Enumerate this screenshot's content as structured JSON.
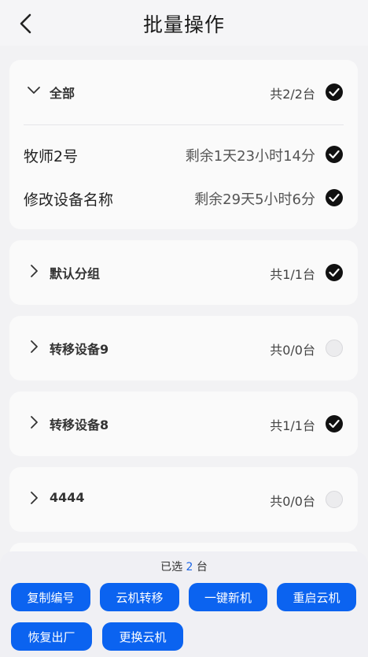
{
  "header": {
    "title": "批量操作",
    "back_icon": "chevron-left-icon"
  },
  "groups": [
    {
      "name": "全部",
      "count": "共2/2台",
      "expanded": true,
      "checked": true,
      "devices": [
        {
          "name": "牧师2号",
          "remaining": "剩余1天23小时14分",
          "checked": true
        },
        {
          "name": "修改设备名称",
          "remaining": "剩余29天5小时6分",
          "checked": true
        }
      ]
    },
    {
      "name": "默认分组",
      "count": "共1/1台",
      "expanded": false,
      "checked": true
    },
    {
      "name": "转移设备9",
      "count": "共0/0台",
      "expanded": false,
      "checked": false
    },
    {
      "name": "转移设备8",
      "count": "共1/1台",
      "expanded": false,
      "checked": true
    },
    {
      "name": "4444",
      "count": "共0/0台",
      "expanded": false,
      "checked": false
    }
  ],
  "footer": {
    "selected_prefix": "已选",
    "selected_count": "2",
    "selected_suffix": "台",
    "buttons": [
      "复制编号",
      "云机转移",
      "一键新机",
      "重启云机",
      "恢复出厂",
      "更换云机"
    ]
  },
  "colors": {
    "accent": "#0b63f0",
    "check_on": "#111111",
    "check_off": "#ececee"
  }
}
